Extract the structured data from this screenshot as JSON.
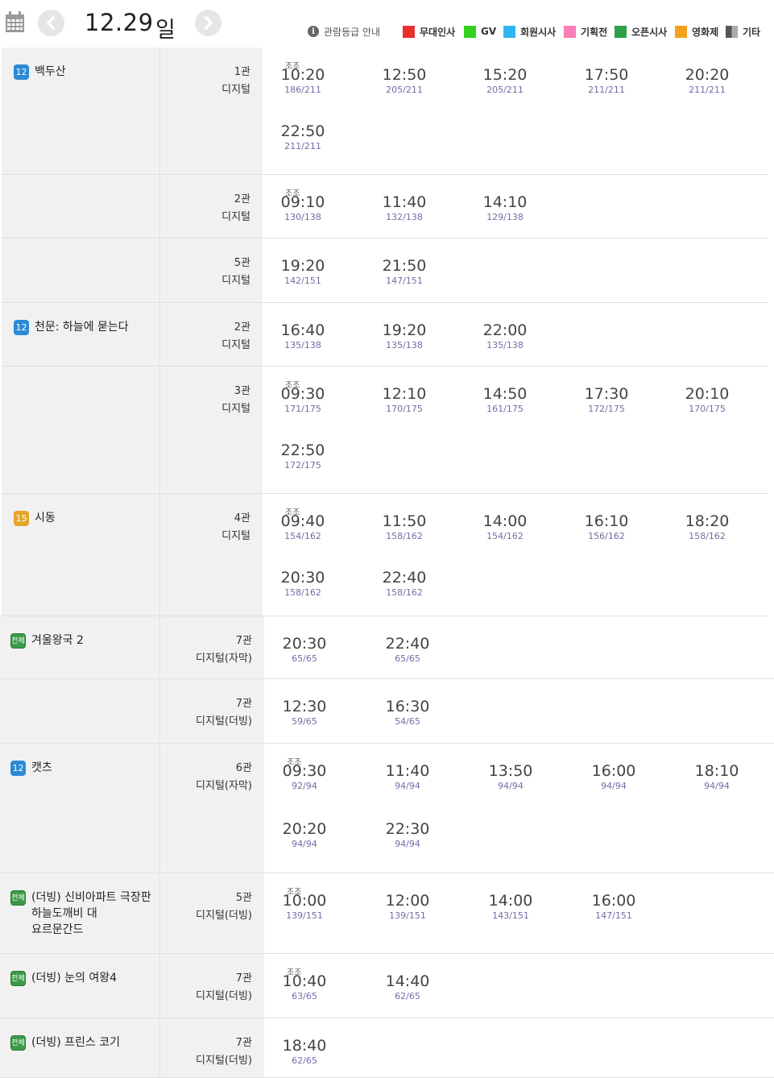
{
  "header": {
    "date": "12.29",
    "weekday": "일",
    "icons": {
      "calendar": "calendar-icon",
      "prev": "chevron-left-icon",
      "next": "chevron-right-icon"
    }
  },
  "legend": {
    "info_label": "관람등급 안내",
    "items": [
      {
        "label": "무대인사",
        "color": "#e8312f"
      },
      {
        "label": "GV",
        "color": "#33d01e"
      },
      {
        "label": "회원시사",
        "color": "#2eb6f0"
      },
      {
        "label": "기획전",
        "color": "#f77fb6"
      },
      {
        "label": "오픈시사",
        "color": "#2ea04a"
      },
      {
        "label": "영화제",
        "color": "#f4a21c"
      },
      {
        "label": "기타",
        "color": "#666666"
      }
    ]
  },
  "rows": [
    {
      "rating": "12",
      "title": "백두산",
      "hall": "1관",
      "format": "디지털",
      "times": [
        {
          "tag": "조조",
          "time": "10:20",
          "seats": "186/211"
        },
        {
          "time": "12:50",
          "seats": "205/211"
        },
        {
          "time": "15:20",
          "seats": "205/211"
        },
        {
          "time": "17:50",
          "seats": "211/211"
        },
        {
          "time": "20:20",
          "seats": "211/211"
        },
        {
          "time": "22:50",
          "seats": "211/211"
        }
      ]
    },
    {
      "rating": "",
      "title": "",
      "hall": "2관",
      "format": "디지털",
      "times": [
        {
          "tag": "조조",
          "time": "09:10",
          "seats": "130/138"
        },
        {
          "time": "11:40",
          "seats": "132/138"
        },
        {
          "time": "14:10",
          "seats": "129/138"
        }
      ]
    },
    {
      "rating": "",
      "title": "",
      "hall": "5관",
      "format": "디지털",
      "times": [
        {
          "time": "19:20",
          "seats": "142/151"
        },
        {
          "time": "21:50",
          "seats": "147/151"
        }
      ]
    },
    {
      "rating": "12",
      "title": "천문: 하늘에 묻는다",
      "hall": "2관",
      "format": "디지털",
      "times": [
        {
          "time": "16:40",
          "seats": "135/138"
        },
        {
          "time": "19:20",
          "seats": "135/138"
        },
        {
          "time": "22:00",
          "seats": "135/138"
        }
      ]
    },
    {
      "rating": "",
      "title": "",
      "hall": "3관",
      "format": "디지털",
      "times": [
        {
          "tag": "조조",
          "time": "09:30",
          "seats": "171/175"
        },
        {
          "time": "12:10",
          "seats": "170/175"
        },
        {
          "time": "14:50",
          "seats": "161/175"
        },
        {
          "time": "17:30",
          "seats": "172/175"
        },
        {
          "time": "20:10",
          "seats": "170/175"
        },
        {
          "time": "22:50",
          "seats": "172/175"
        }
      ]
    },
    {
      "rating": "15",
      "title": "시동",
      "hall": "4관",
      "format": "디지털",
      "times": [
        {
          "tag": "조조",
          "time": "09:40",
          "seats": "154/162"
        },
        {
          "time": "11:50",
          "seats": "158/162"
        },
        {
          "time": "14:00",
          "seats": "154/162"
        },
        {
          "time": "16:10",
          "seats": "156/162"
        },
        {
          "time": "18:20",
          "seats": "158/162"
        },
        {
          "time": "20:30",
          "seats": "158/162"
        },
        {
          "time": "22:40",
          "seats": "158/162"
        }
      ]
    },
    {
      "rating": "전체",
      "title": "겨울왕국 2",
      "hall": "7관",
      "format": "디지털(자막)",
      "times": [
        {
          "time": "20:30",
          "seats": "65/65"
        },
        {
          "time": "22:40",
          "seats": "65/65"
        }
      ]
    },
    {
      "rating": "",
      "title": "",
      "hall": "7관",
      "format": "디지털(더빙)",
      "times": [
        {
          "time": "12:30",
          "seats": "59/65"
        },
        {
          "time": "16:30",
          "seats": "54/65"
        }
      ]
    },
    {
      "rating": "12",
      "title": "캣츠",
      "hall": "6관",
      "format": "디지털(자막)",
      "times": [
        {
          "tag": "조조",
          "time": "09:30",
          "seats": "92/94"
        },
        {
          "time": "11:40",
          "seats": "94/94"
        },
        {
          "time": "13:50",
          "seats": "94/94"
        },
        {
          "time": "16:00",
          "seats": "94/94"
        },
        {
          "time": "18:10",
          "seats": "94/94"
        },
        {
          "time": "20:20",
          "seats": "94/94"
        },
        {
          "time": "22:30",
          "seats": "94/94"
        }
      ]
    },
    {
      "rating": "전체",
      "title": "(더빙) 신비아파트 극장판 하늘도깨비 대 요르문간드",
      "hall": "5관",
      "format": "디지털(더빙)",
      "times": [
        {
          "tag": "조조",
          "time": "10:00",
          "seats": "139/151"
        },
        {
          "time": "12:00",
          "seats": "139/151"
        },
        {
          "time": "14:00",
          "seats": "143/151"
        },
        {
          "time": "16:00",
          "seats": "147/151"
        }
      ]
    },
    {
      "rating": "전체",
      "title": "(더빙) 눈의 여왕4",
      "hall": "7관",
      "format": "디지털(더빙)",
      "times": [
        {
          "tag": "조조",
          "time": "10:40",
          "seats": "63/65"
        },
        {
          "time": "14:40",
          "seats": "62/65"
        }
      ]
    },
    {
      "rating": "전체",
      "title": "(더빙) 프린스 코기",
      "hall": "7관",
      "format": "디지털(더빙)",
      "times": [
        {
          "time": "18:40",
          "seats": "62/65"
        }
      ]
    }
  ]
}
